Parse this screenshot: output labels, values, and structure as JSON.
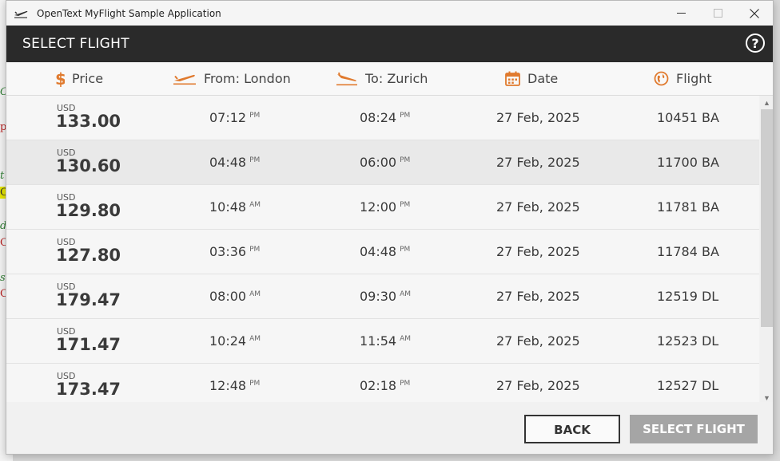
{
  "window": {
    "title": "OpenText MyFlight Sample Application"
  },
  "header": {
    "title": "SELECT FLIGHT",
    "help_label": "?"
  },
  "columns": {
    "price": "Price",
    "from": "From: London",
    "to": "To: Zurich",
    "date": "Date",
    "flight": "Flight"
  },
  "flights": [
    {
      "currency": "USD",
      "price": "133.00",
      "dep_time": "07:12",
      "dep_ampm": "PM",
      "arr_time": "08:24",
      "arr_ampm": "PM",
      "date": "27 Feb, 2025",
      "flight": "10451 BA"
    },
    {
      "currency": "USD",
      "price": "130.60",
      "dep_time": "04:48",
      "dep_ampm": "PM",
      "arr_time": "06:00",
      "arr_ampm": "PM",
      "date": "27 Feb, 2025",
      "flight": "11700 BA"
    },
    {
      "currency": "USD",
      "price": "129.80",
      "dep_time": "10:48",
      "dep_ampm": "AM",
      "arr_time": "12:00",
      "arr_ampm": "PM",
      "date": "27 Feb, 2025",
      "flight": "11781 BA"
    },
    {
      "currency": "USD",
      "price": "127.80",
      "dep_time": "03:36",
      "dep_ampm": "PM",
      "arr_time": "04:48",
      "arr_ampm": "PM",
      "date": "27 Feb, 2025",
      "flight": "11784 BA"
    },
    {
      "currency": "USD",
      "price": "179.47",
      "dep_time": "08:00",
      "dep_ampm": "AM",
      "arr_time": "09:30",
      "arr_ampm": "AM",
      "date": "27 Feb, 2025",
      "flight": "12519 DL"
    },
    {
      "currency": "USD",
      "price": "171.47",
      "dep_time": "10:24",
      "dep_ampm": "AM",
      "arr_time": "11:54",
      "arr_ampm": "AM",
      "date": "27 Feb, 2025",
      "flight": "12523 DL"
    },
    {
      "currency": "USD",
      "price": "173.47",
      "dep_time": "12:48",
      "dep_ampm": "PM",
      "arr_time": "02:18",
      "arr_ampm": "PM",
      "date": "27 Feb, 2025",
      "flight": "12527 DL"
    }
  ],
  "footer": {
    "back_label": "BACK",
    "select_label": "SELECT FLIGHT"
  },
  "background_fragments": [
    "C",
    "p",
    "t",
    "C",
    "d",
    "C",
    "sp",
    "C"
  ],
  "colors": {
    "accent": "#e07a2e",
    "header_bg": "#2a2a2a",
    "select_disabled": "#a5a5a5"
  },
  "icons": {
    "app": "plane-takeoff-icon",
    "price": "dollar-icon",
    "from": "plane-takeoff-icon",
    "to": "plane-landing-icon",
    "date": "calendar-icon",
    "flight": "globe-icon"
  }
}
